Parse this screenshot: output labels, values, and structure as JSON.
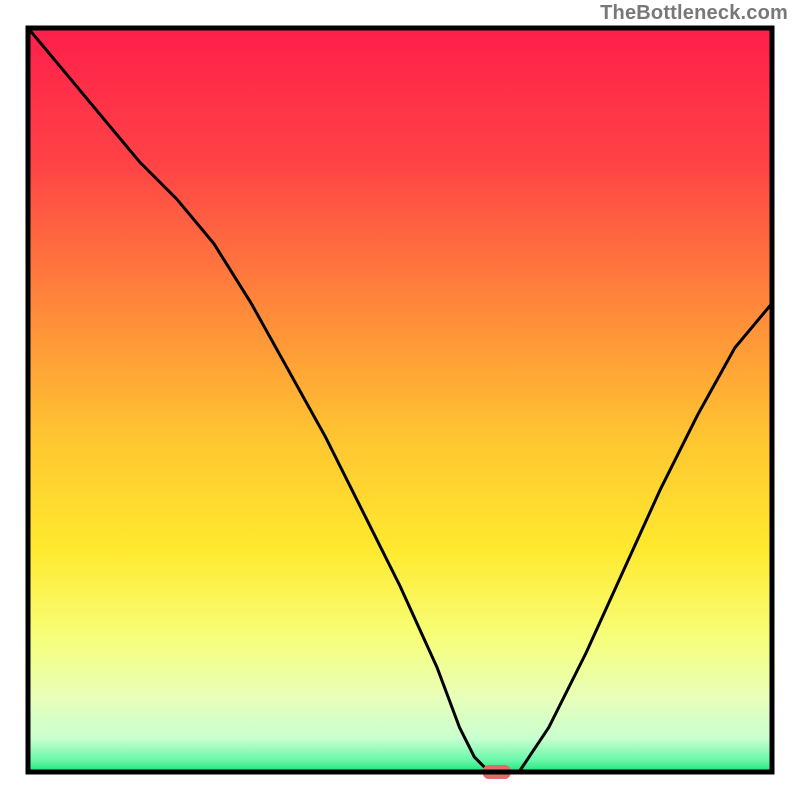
{
  "watermark": "TheBottleneck.com",
  "chart_data": {
    "type": "line",
    "title": "",
    "xlabel": "",
    "ylabel": "",
    "xlim": [
      0,
      100
    ],
    "ylim": [
      0,
      100
    ],
    "series": [
      {
        "name": "bottleneck-curve",
        "x": [
          0,
          5,
          10,
          15,
          20,
          25,
          30,
          35,
          40,
          45,
          50,
          55,
          58,
          60,
          62,
          64,
          66,
          70,
          75,
          80,
          85,
          90,
          95,
          100
        ],
        "y": [
          100,
          94,
          88,
          82,
          77,
          71,
          63,
          54,
          45,
          35,
          25,
          14,
          6,
          2,
          0,
          0,
          0,
          6,
          16,
          27,
          38,
          48,
          57,
          63
        ]
      }
    ],
    "marker": {
      "x": 63,
      "y": 0,
      "color": "#e46a6a"
    },
    "gradient_stops": [
      {
        "offset": 0.0,
        "color": "#ff1f4b"
      },
      {
        "offset": 0.18,
        "color": "#ff4246"
      },
      {
        "offset": 0.38,
        "color": "#ff8a3a"
      },
      {
        "offset": 0.55,
        "color": "#ffc531"
      },
      {
        "offset": 0.7,
        "color": "#ffe92e"
      },
      {
        "offset": 0.82,
        "color": "#f6ff7a"
      },
      {
        "offset": 0.9,
        "color": "#e8ffb9"
      },
      {
        "offset": 0.955,
        "color": "#c9ffd0"
      },
      {
        "offset": 0.985,
        "color": "#66f7a8"
      },
      {
        "offset": 1.0,
        "color": "#18e57a"
      }
    ],
    "frame_color": "#000000",
    "curve_color": "#000000"
  }
}
